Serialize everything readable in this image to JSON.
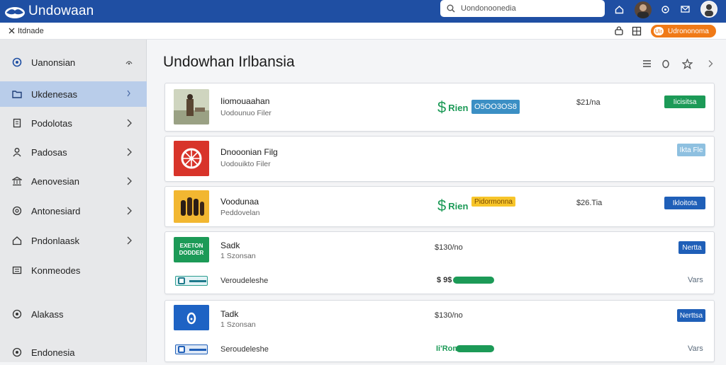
{
  "header": {
    "app_title": "Undowaan",
    "search_placeholder": "Uondonoonedia",
    "brand_color": "#1f4fa3"
  },
  "subbar": {
    "breadcrumb": "Itdnade",
    "pill_label": "Udrononoma",
    "pill_badge": "Uir"
  },
  "sidebar": {
    "items": [
      {
        "label": "Uanonsian",
        "icon": "globe-icon"
      },
      {
        "label": "Ukdenesas",
        "icon": "folder-icon"
      },
      {
        "label": "Podolotas",
        "icon": "document-icon"
      },
      {
        "label": "Padosas",
        "icon": "user-icon"
      },
      {
        "label": "Aenovesian",
        "icon": "bank-icon"
      },
      {
        "label": "Antonesiard",
        "icon": "at-icon"
      },
      {
        "label": "Pndonlaask",
        "icon": "home-icon"
      },
      {
        "label": "Konmeodes",
        "icon": "list-icon"
      },
      {
        "label": "Alakass",
        "icon": "target-icon"
      },
      {
        "label": "Endonesia",
        "icon": "globe-icon"
      }
    ]
  },
  "main": {
    "title": "Undowhan Irlbansia",
    "cards": [
      {
        "name": "Iiomouaahan",
        "sub": "Uodounuo Filer",
        "price_glyph": "$",
        "price_label": "Rien",
        "tag": "O5OO3OS8",
        "amount": "$21/na",
        "action": "Iicisitsa"
      },
      {
        "name": "Dnooonian Filg",
        "sub": "Uodouikto Filer",
        "action": "Ikta Fle"
      },
      {
        "name": "Voodunaa",
        "sub": "Peddovelan",
        "price_glyph": "$",
        "price_label": "Rien",
        "tag": "Pidormonna",
        "amount": "$26.Tia",
        "action": "Ikloitota"
      },
      {
        "name": "Sadk",
        "sub": "1 Szonsan",
        "thumb_text_1": "EXETON",
        "thumb_text_2": "DODDER",
        "amount": "$130/no",
        "action": "Nertta",
        "row2_label": "Veroudeleshe",
        "row2_price": "$ 9$",
        "row2_progress": 0.7,
        "row2_link": "Vars"
      },
      {
        "name": "Tadk",
        "sub": "1 Szonsan",
        "amount": "$130/no",
        "action": "Nerttsa",
        "row2_label": "Seroudeleshe",
        "row2_price": "Ii'Rom",
        "row2_progress": 0.7,
        "row2_link": "Vars"
      }
    ]
  }
}
